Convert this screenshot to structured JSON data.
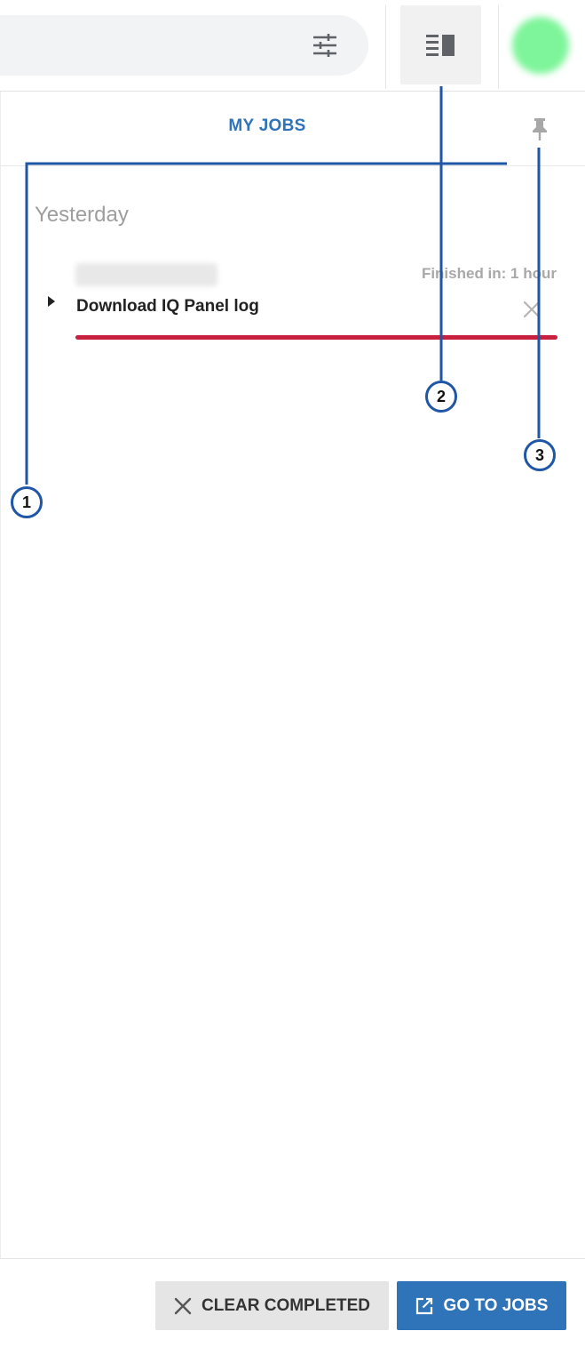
{
  "topbar": {
    "icons": {
      "filter": "tune-sliders-icon",
      "panel_toggle": "panel-toggle-icon",
      "avatar": "user-avatar"
    }
  },
  "panel": {
    "tab_label": "MY JOBS",
    "pin_icon": "pin-icon",
    "group_label": "Yesterday",
    "jobs": [
      {
        "name": "Download IQ Panel log",
        "duration": "Finished in: 1 hour",
        "status_color": "#c8203f"
      }
    ]
  },
  "footer": {
    "clear_label": "CLEAR COMPLETED",
    "goto_label": "GO TO JOBS"
  },
  "callouts": [
    "1",
    "2",
    "3"
  ],
  "colors": {
    "accent": "#2f73b9",
    "error": "#c8203f",
    "callout": "#1f56a5"
  }
}
